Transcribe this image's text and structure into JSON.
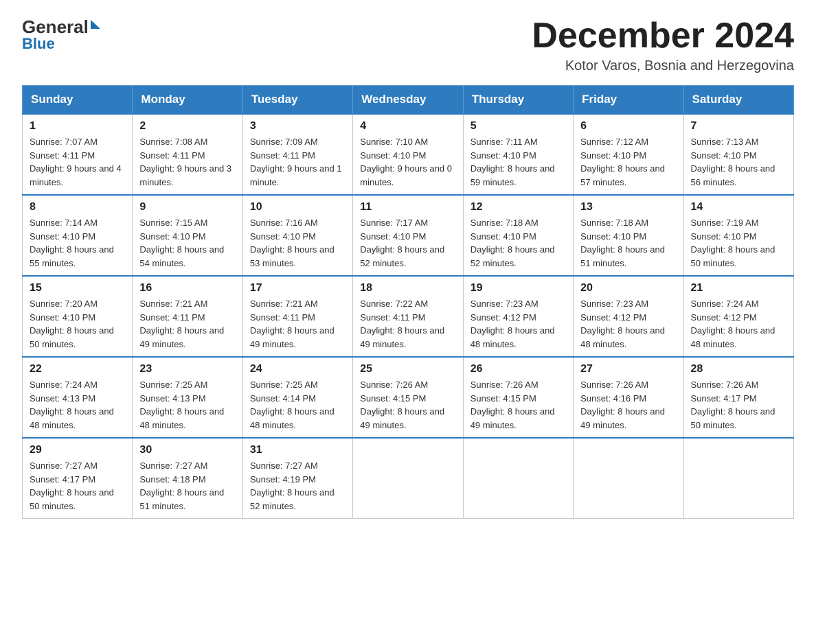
{
  "logo": {
    "general": "General",
    "blue": "Blue",
    "tagline": "Blue"
  },
  "title": "December 2024",
  "subtitle": "Kotor Varos, Bosnia and Herzegovina",
  "days_of_week": [
    "Sunday",
    "Monday",
    "Tuesday",
    "Wednesday",
    "Thursday",
    "Friday",
    "Saturday"
  ],
  "weeks": [
    [
      {
        "num": "1",
        "sunrise": "7:07 AM",
        "sunset": "4:11 PM",
        "daylight": "9 hours and 4 minutes."
      },
      {
        "num": "2",
        "sunrise": "7:08 AM",
        "sunset": "4:11 PM",
        "daylight": "9 hours and 3 minutes."
      },
      {
        "num": "3",
        "sunrise": "7:09 AM",
        "sunset": "4:11 PM",
        "daylight": "9 hours and 1 minute."
      },
      {
        "num": "4",
        "sunrise": "7:10 AM",
        "sunset": "4:10 PM",
        "daylight": "9 hours and 0 minutes."
      },
      {
        "num": "5",
        "sunrise": "7:11 AM",
        "sunset": "4:10 PM",
        "daylight": "8 hours and 59 minutes."
      },
      {
        "num": "6",
        "sunrise": "7:12 AM",
        "sunset": "4:10 PM",
        "daylight": "8 hours and 57 minutes."
      },
      {
        "num": "7",
        "sunrise": "7:13 AM",
        "sunset": "4:10 PM",
        "daylight": "8 hours and 56 minutes."
      }
    ],
    [
      {
        "num": "8",
        "sunrise": "7:14 AM",
        "sunset": "4:10 PM",
        "daylight": "8 hours and 55 minutes."
      },
      {
        "num": "9",
        "sunrise": "7:15 AM",
        "sunset": "4:10 PM",
        "daylight": "8 hours and 54 minutes."
      },
      {
        "num": "10",
        "sunrise": "7:16 AM",
        "sunset": "4:10 PM",
        "daylight": "8 hours and 53 minutes."
      },
      {
        "num": "11",
        "sunrise": "7:17 AM",
        "sunset": "4:10 PM",
        "daylight": "8 hours and 52 minutes."
      },
      {
        "num": "12",
        "sunrise": "7:18 AM",
        "sunset": "4:10 PM",
        "daylight": "8 hours and 52 minutes."
      },
      {
        "num": "13",
        "sunrise": "7:18 AM",
        "sunset": "4:10 PM",
        "daylight": "8 hours and 51 minutes."
      },
      {
        "num": "14",
        "sunrise": "7:19 AM",
        "sunset": "4:10 PM",
        "daylight": "8 hours and 50 minutes."
      }
    ],
    [
      {
        "num": "15",
        "sunrise": "7:20 AM",
        "sunset": "4:10 PM",
        "daylight": "8 hours and 50 minutes."
      },
      {
        "num": "16",
        "sunrise": "7:21 AM",
        "sunset": "4:11 PM",
        "daylight": "8 hours and 49 minutes."
      },
      {
        "num": "17",
        "sunrise": "7:21 AM",
        "sunset": "4:11 PM",
        "daylight": "8 hours and 49 minutes."
      },
      {
        "num": "18",
        "sunrise": "7:22 AM",
        "sunset": "4:11 PM",
        "daylight": "8 hours and 49 minutes."
      },
      {
        "num": "19",
        "sunrise": "7:23 AM",
        "sunset": "4:12 PM",
        "daylight": "8 hours and 48 minutes."
      },
      {
        "num": "20",
        "sunrise": "7:23 AM",
        "sunset": "4:12 PM",
        "daylight": "8 hours and 48 minutes."
      },
      {
        "num": "21",
        "sunrise": "7:24 AM",
        "sunset": "4:12 PM",
        "daylight": "8 hours and 48 minutes."
      }
    ],
    [
      {
        "num": "22",
        "sunrise": "7:24 AM",
        "sunset": "4:13 PM",
        "daylight": "8 hours and 48 minutes."
      },
      {
        "num": "23",
        "sunrise": "7:25 AM",
        "sunset": "4:13 PM",
        "daylight": "8 hours and 48 minutes."
      },
      {
        "num": "24",
        "sunrise": "7:25 AM",
        "sunset": "4:14 PM",
        "daylight": "8 hours and 48 minutes."
      },
      {
        "num": "25",
        "sunrise": "7:26 AM",
        "sunset": "4:15 PM",
        "daylight": "8 hours and 49 minutes."
      },
      {
        "num": "26",
        "sunrise": "7:26 AM",
        "sunset": "4:15 PM",
        "daylight": "8 hours and 49 minutes."
      },
      {
        "num": "27",
        "sunrise": "7:26 AM",
        "sunset": "4:16 PM",
        "daylight": "8 hours and 49 minutes."
      },
      {
        "num": "28",
        "sunrise": "7:26 AM",
        "sunset": "4:17 PM",
        "daylight": "8 hours and 50 minutes."
      }
    ],
    [
      {
        "num": "29",
        "sunrise": "7:27 AM",
        "sunset": "4:17 PM",
        "daylight": "8 hours and 50 minutes."
      },
      {
        "num": "30",
        "sunrise": "7:27 AM",
        "sunset": "4:18 PM",
        "daylight": "8 hours and 51 minutes."
      },
      {
        "num": "31",
        "sunrise": "7:27 AM",
        "sunset": "4:19 PM",
        "daylight": "8 hours and 52 minutes."
      },
      null,
      null,
      null,
      null
    ]
  ]
}
